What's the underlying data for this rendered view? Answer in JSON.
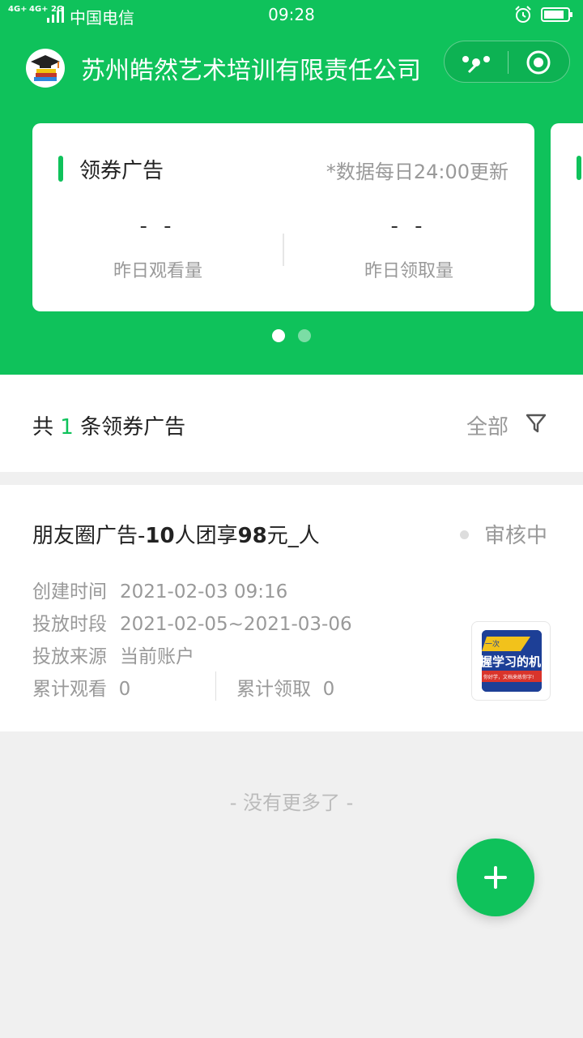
{
  "status_bar": {
    "signal_1": "4G+",
    "signal_2": "4G+ 2G",
    "carrier": "中国电信",
    "time": "09:28"
  },
  "header": {
    "company_name": "苏州皓然艺术培训有限责任公司",
    "accent_color": "#0fc25b"
  },
  "stats_card": {
    "title": "领券广告",
    "note": "*数据每日24:00更新",
    "stats": [
      {
        "value": "- -",
        "label": "昨日观看量"
      },
      {
        "value": "- -",
        "label": "昨日领取量"
      }
    ]
  },
  "summary": {
    "prefix": "共",
    "count": "1",
    "suffix": "条领券广告",
    "filter_label": "全部"
  },
  "ad": {
    "title_part1": "朋友圈广告-",
    "title_bold1": "10",
    "title_part2": "人团享",
    "title_bold2": "98",
    "title_part3": "元_人",
    "status": "审核中",
    "created_label": "创建时间",
    "created_value": "2021-02-03 09:16",
    "period_label": "投放时段",
    "period_value": "2021-02-05~2021-03-06",
    "source_label": "投放来源",
    "source_value": "当前账户",
    "views_label": "累计观看",
    "views_value": "0",
    "claims_label": "累计领取",
    "claims_value": "0",
    "thumb_text_1": "一次",
    "thumb_text_2": "握学习的机",
    "thumb_text_3": "你好学，文档来练你字!"
  },
  "footer": {
    "no_more": "-   没有更多了   -"
  }
}
